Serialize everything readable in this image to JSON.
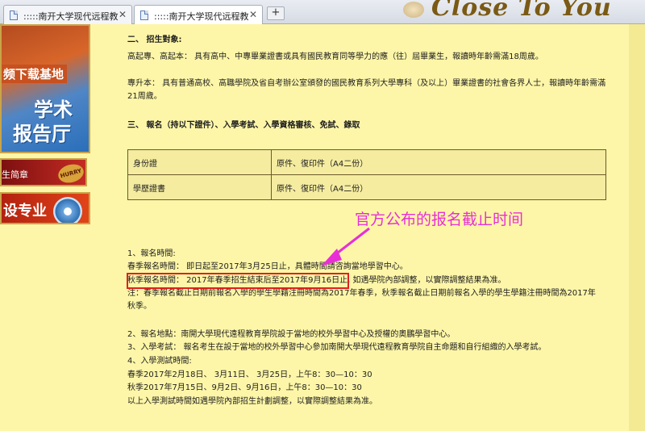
{
  "tabs": [
    {
      "title": ":::::南开大学现代远程教育",
      "close": "✕",
      "icon": "document-icon"
    },
    {
      "title": ":::::南开大学现代远程教育",
      "close": "✕",
      "icon": "document-icon"
    }
  ],
  "new_tab_label": "+",
  "brand": "Close To You",
  "sidebar": {
    "download_label": "频下载基地",
    "academic_1": "学术",
    "academic_2": "报告厅",
    "admission_brief": "生简章",
    "hurry_badge": "HURRY",
    "majors_label": "设专业"
  },
  "content": {
    "section2_title": "二、 招生對象:",
    "section2_p1": "高起專、高起本： 具有高中、中專畢業證書或具有國民教育同等學力的應（往）屆畢業生，報讀時年齡需滿18周歲。",
    "section2_p2": "專升本： 具有普通高校、高職學院及省自考辦公室頒發的國民教育系列大學專科（及以上）畢業證書的社會各界人士，報讀時年齡需滿21周歲。",
    "section3_title": "三、 報名（持以下證件）、入學考試、入學資格審核、免試、錄取",
    "docs_table": [
      {
        "doc": "身份證",
        "requirement": "原件、復印件（A4二份）"
      },
      {
        "doc": "學歷證書",
        "requirement": "原件、復印件（A4二份）"
      }
    ],
    "p_reg_time_title": "1、報名時間:",
    "p_spring": "春季報名時間： 即日起至2017年3月25日止，具體時間請咨詢當地學習中心。",
    "p_autumn_highlight": "秋季報名時間： 2017年春季招生結束后至2017年9月16日止,",
    "p_autumn_rest": "如遇學院內部調整，以實際調整結果為准。",
    "p_note_1": "注：春季報名截止日期前報名入學的學生學籍注冊時間為2017年春季，秋季報名截止日期前報名入學的學生學籍注冊時間為2017年",
    "p_note_2": "秋季。",
    "p_location": "2、報名地點：南開大學現代遠程教育學院設于當地的校外學習中心及授權的奧鵬學習中心。",
    "p_exam": "3、入學考試： 報名考生在設于當地的校外學習中心參加南開大學現代遠程教育學院自主命題和自行組織的入學考試。",
    "p_exam_time_title": "4、入學測試時間:",
    "p_spring_exam": "春季2017年2月18日、 3月11日、 3月25日，上午8：30—10：30",
    "p_autumn_exam": "秋季2017年7月15日、9月2日、9月16日，上午8：30—10：30",
    "p_exam_note": "以上入學測試時間如遇學院內部招生計劃調整，以實際調整結果為准。"
  },
  "annotation": {
    "text": "官方公布的报名截止时间",
    "color": "#e82fd6",
    "box_color": "#e02020"
  }
}
